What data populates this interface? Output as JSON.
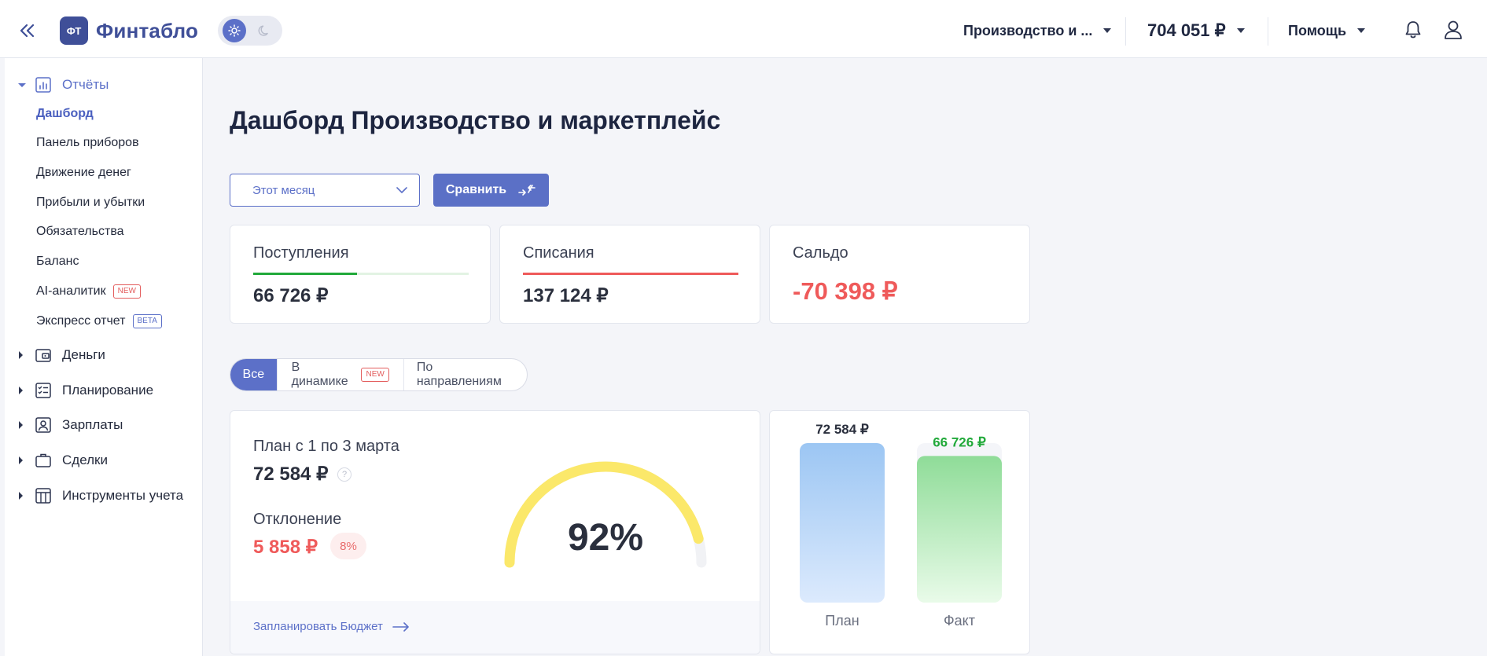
{
  "header": {
    "logo_mark": "ФТ",
    "logo_text": "Финтабло",
    "company": "Производство и ...",
    "balance": "704 051 ₽",
    "help": "Помощь"
  },
  "sidebar": {
    "sections": [
      {
        "label": "Отчёты",
        "icon": "reports-icon",
        "expanded": true
      },
      {
        "label": "Деньги",
        "icon": "wallet-icon",
        "expanded": false
      },
      {
        "label": "Планирование",
        "icon": "checklist-icon",
        "expanded": false
      },
      {
        "label": "Зарплаты",
        "icon": "person-card-icon",
        "expanded": false
      },
      {
        "label": "Сделки",
        "icon": "briefcase-icon",
        "expanded": false
      },
      {
        "label": "Инструменты учета",
        "icon": "table-icon",
        "expanded": false
      }
    ],
    "reports": [
      {
        "label": "Дашборд",
        "active": true
      },
      {
        "label": "Панель приборов"
      },
      {
        "label": "Движение денег"
      },
      {
        "label": "Прибыли и убытки"
      },
      {
        "label": "Обязательства"
      },
      {
        "label": "Баланс"
      },
      {
        "label": "AI-аналитик",
        "badge": "NEW"
      },
      {
        "label": "Экспресс отчет",
        "badge": "BETA"
      }
    ]
  },
  "main": {
    "title": "Дашборд Производство и маркетплейс",
    "period": "Этот месяц",
    "compare_label": "Сравнить",
    "kpis": {
      "income": {
        "title": "Поступления",
        "value": "66 726 ₽",
        "bar_fill": 0.48,
        "color": "#21a93a"
      },
      "expense": {
        "title": "Списания",
        "value": "137 124 ₽",
        "bar_fill": 1.0,
        "color": "#ef5a5a"
      },
      "saldo": {
        "title": "Сальдо",
        "value": "-70 398 ₽",
        "color": "#ef5a5a"
      }
    },
    "tabs": [
      {
        "label": "Все",
        "active": true
      },
      {
        "label": "В динамике",
        "badge": "NEW"
      },
      {
        "label": "По направлениям"
      }
    ],
    "plan": {
      "plan_label": "План с 1 по 3 марта",
      "plan_value": "72 584 ₽",
      "help_mark": "?",
      "deviation_label": "Отклонение",
      "deviation_value": "5 858 ₽",
      "deviation_pct": "8%",
      "gauge_percent": 92,
      "gauge_label": "92%",
      "link": "Запланировать Бюджет"
    },
    "colors": {
      "accent": "#5c70c8",
      "positive": "#21a93a",
      "negative": "#ef5a5a",
      "gauge": "#fbe86a"
    }
  },
  "chart_data": {
    "type": "bar",
    "categories": [
      "План",
      "Факт"
    ],
    "values": [
      72584,
      66726
    ],
    "value_labels": [
      "72 584 ₽",
      "66 726 ₽"
    ],
    "label_colors": [
      "#2a2f3d",
      "#21a93a"
    ],
    "ylim": [
      0,
      72584
    ]
  }
}
